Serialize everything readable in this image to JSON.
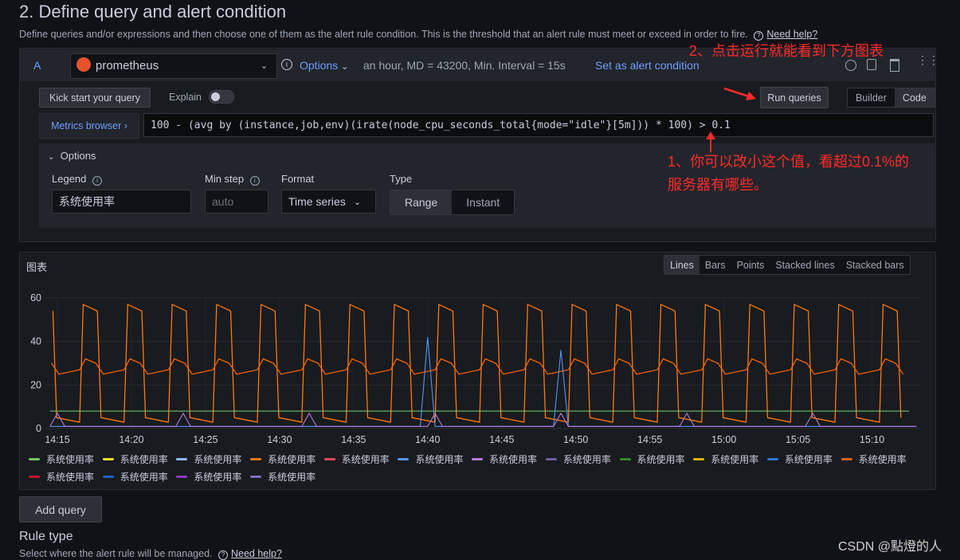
{
  "section": {
    "title": "2. Define query and alert condition",
    "description": "Define queries and/or expressions and then choose one of them as the alert rule condition. This is the threshold that an alert rule must meet or exceed in order to fire.",
    "help_link": "Need help?"
  },
  "query": {
    "ref_id": "A",
    "datasource": "prometheus",
    "options_label": "Options",
    "options_summary": "an hour, MD = 43200, Min. Interval = 15s",
    "set_condition": "Set as alert condition",
    "kick_start": "Kick start your query",
    "explain_label": "Explain",
    "run_queries": "Run queries",
    "mode_builder": "Builder",
    "mode_code": "Code",
    "metrics_browser": "Metrics browser",
    "expression": "100 - (avg by (instance,job,env)(irate(node_cpu_seconds_total{mode=\"idle\"}[5m])) * 100) > 0.1",
    "options": {
      "header": "Options",
      "legend_label": "Legend",
      "legend_value": "系统使用率",
      "min_step_label": "Min step",
      "min_step_placeholder": "auto",
      "format_label": "Format",
      "format_value": "Time series",
      "type_label": "Type",
      "type_range": "Range",
      "type_instant": "Instant"
    }
  },
  "annotations": {
    "note2": "2、点击运行就能看到下方图表",
    "note1_line1": "1、你可以改小这个值，看超过0.1%的",
    "note1_line2": "服务器有哪些。"
  },
  "graph": {
    "title": "图表",
    "view_modes": [
      "Lines",
      "Bars",
      "Points",
      "Stacked lines",
      "Stacked bars"
    ],
    "active_view": "Lines",
    "legend_items": [
      {
        "label": "系统使用率",
        "color": "#73bf69"
      },
      {
        "label": "系统使用率",
        "color": "#fade2a"
      },
      {
        "label": "系统使用率",
        "color": "#8ab8ff"
      },
      {
        "label": "系统使用率",
        "color": "#ff780a"
      },
      {
        "label": "系统使用率",
        "color": "#f2495c"
      },
      {
        "label": "系统使用率",
        "color": "#5794f2"
      },
      {
        "label": "系统使用率",
        "color": "#b877d9"
      },
      {
        "label": "系统使用率",
        "color": "#705da0"
      },
      {
        "label": "系统使用率",
        "color": "#37872d"
      },
      {
        "label": "系统使用率",
        "color": "#e0b400"
      },
      {
        "label": "系统使用率",
        "color": "#3274d9"
      },
      {
        "label": "系统使用率",
        "color": "#fa6400"
      },
      {
        "label": "系统使用率",
        "color": "#c4162a"
      },
      {
        "label": "系统使用率",
        "color": "#1f60c4"
      },
      {
        "label": "系统使用率",
        "color": "#8f3bb8"
      },
      {
        "label": "系统使用率",
        "color": "#806eb7"
      }
    ]
  },
  "chart_data": {
    "type": "line",
    "x": [
      "14:15",
      "14:20",
      "14:25",
      "14:30",
      "14:35",
      "14:40",
      "14:45",
      "14:50",
      "14:55",
      "15:00",
      "15:05",
      "15:10"
    ],
    "ylim": [
      0,
      60
    ],
    "yticks": [
      0,
      20,
      40,
      60
    ],
    "grid": true,
    "series": [
      {
        "name": "系统使用率",
        "color": "#ff780a",
        "pattern": "periodic spikes",
        "baseline": 3,
        "peak": 57,
        "period_minutes": 3
      },
      {
        "name": "系统使用率",
        "color": "#fa6400",
        "pattern": "periodic oscillation",
        "baseline": 25,
        "peak": 32,
        "period_minutes": 3
      },
      {
        "name": "系统使用率",
        "color": "#73bf69",
        "pattern": "flat",
        "value": 8
      },
      {
        "name": "系统使用率",
        "color": "#5794f2",
        "pattern": "mostly flat with spikes",
        "value": 1,
        "spikes": [
          {
            "x": "14:40",
            "y": 42
          },
          {
            "x": "14:49",
            "y": 36
          }
        ]
      },
      {
        "name": "系统使用率",
        "color": "#b877d9",
        "pattern": "flat with small spikes",
        "value": 1
      }
    ]
  },
  "footer": {
    "add_query": "Add query",
    "rule_type": "Rule type",
    "rule_type_desc": "Select where the alert rule will be managed.",
    "help_link": "Need help?",
    "watermark": "CSDN @點燈的人"
  }
}
